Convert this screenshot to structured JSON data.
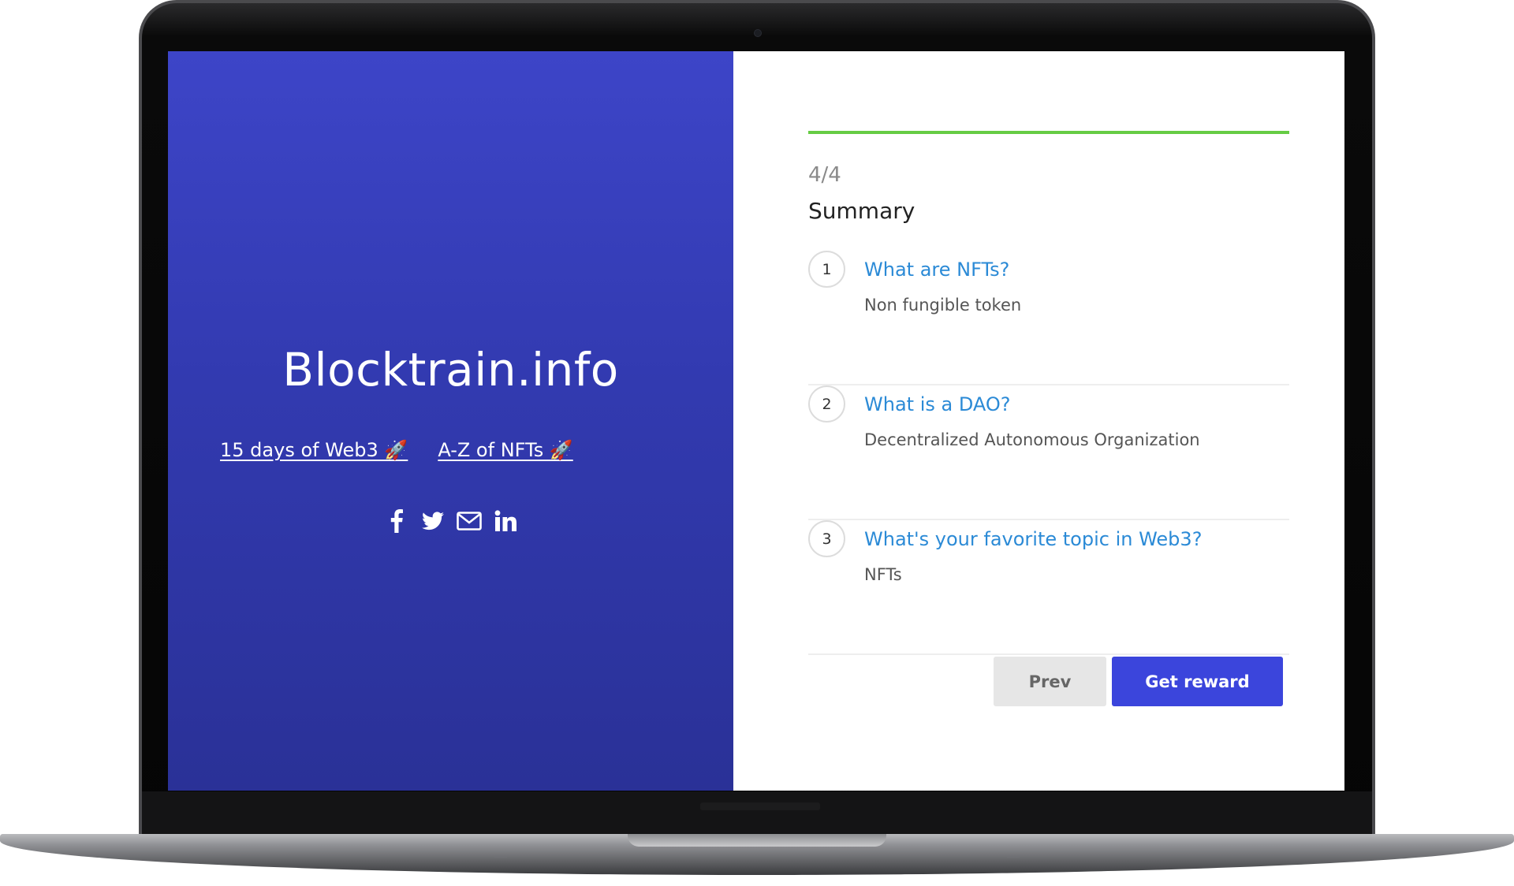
{
  "site": {
    "title": "Blocktrain.info",
    "links": [
      {
        "label": "15 days of Web3 🚀"
      },
      {
        "label": "A-Z of NFTs 🚀"
      }
    ],
    "social_icons": [
      "facebook-icon",
      "twitter-icon",
      "mail-icon",
      "linkedin-icon"
    ]
  },
  "quiz": {
    "progress_fraction": 1.0,
    "progress_color": "#66cc44",
    "step": "4/4",
    "heading": "Summary",
    "items": [
      {
        "number": "1",
        "question": "What are NFTs?",
        "answer": "Non fungible token"
      },
      {
        "number": "2",
        "question": "What is a DAO?",
        "answer": "Decentralized Autonomous Organization"
      },
      {
        "number": "3",
        "question": "What's your favorite topic in Web3?",
        "answer": "NFTs"
      }
    ],
    "buttons": {
      "prev": "Prev",
      "reward": "Get reward"
    }
  },
  "colors": {
    "left_panel": "#3a42c2",
    "accent_link": "#2b8ad6",
    "primary_button": "#3b45dc"
  }
}
